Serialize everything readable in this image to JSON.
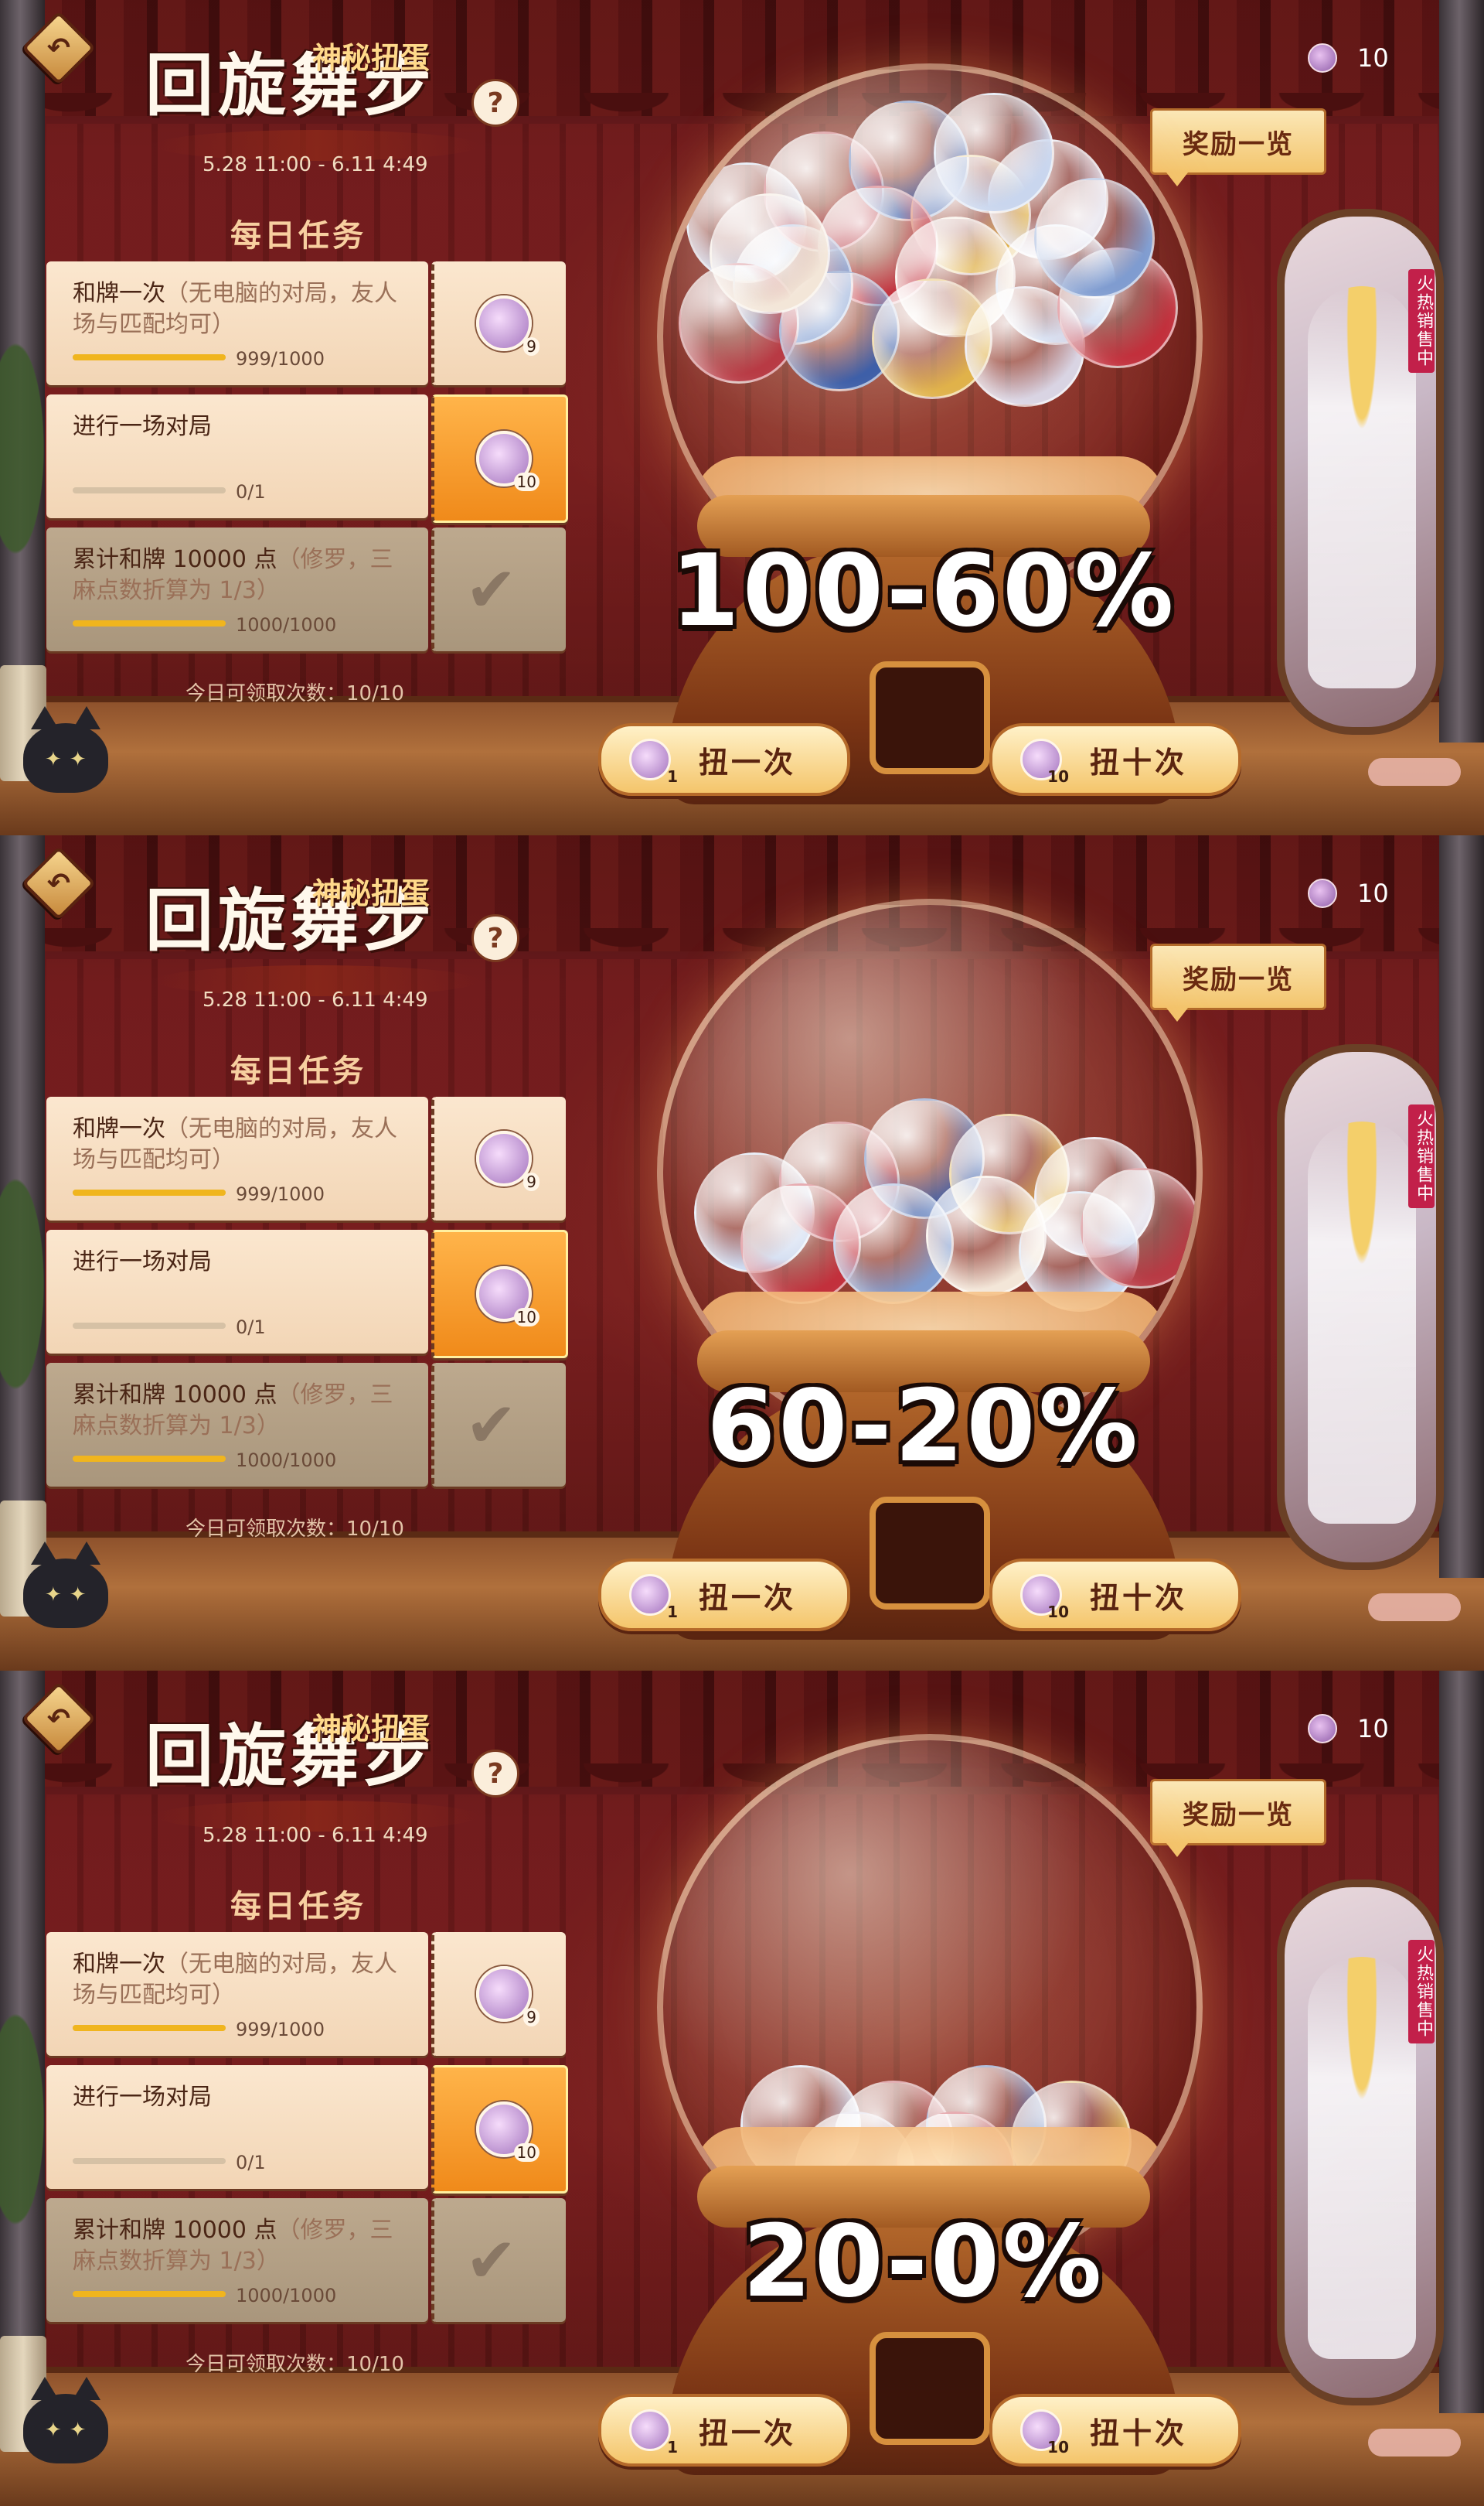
{
  "header": {
    "title_main": "回旋舞步",
    "title_sub": "神秘扭蛋",
    "date_range": "5.28 11:00 - 6.11 4:49",
    "help_label": "?"
  },
  "currency": {
    "count": "10"
  },
  "reward_list_label": "奖励一览",
  "tasks_title": "每日任务",
  "tasks": [
    {
      "desc": "和牌一次",
      "hint": "（无电脑的对局，友人场与匹配均可）",
      "progress": "999/1000",
      "progress_fraction": 0.999,
      "reward_count": "9",
      "state": "normal"
    },
    {
      "desc": "进行一场对局",
      "hint": "",
      "progress": "0/1",
      "progress_fraction": 0,
      "reward_count": "10",
      "state": "active"
    },
    {
      "desc": "累计和牌 10000 点",
      "hint": "（修罗，三麻点数折算为 1/3）",
      "progress": "1000/1000",
      "progress_fraction": 1,
      "reward_count": "",
      "state": "done"
    }
  ],
  "daily_limit": "今日可领取次数：10/10",
  "draw_one": {
    "label": "扭一次",
    "cost": "1"
  },
  "draw_ten": {
    "label": "扭十次",
    "cost": "10"
  },
  "hot_tag": "火热销售中",
  "panels": [
    {
      "percent": "100-60%",
      "capsule_fill": "full"
    },
    {
      "percent": "60-20%",
      "capsule_fill": "half"
    },
    {
      "percent": "20-0%",
      "capsule_fill": "low"
    }
  ],
  "colors": {
    "accent": "#f08a1a",
    "bar": "#f0b51e",
    "hot_tag": "#c2204a"
  },
  "icons": {
    "back": "back-arrow-icon",
    "help": "question-icon",
    "coin": "swan-token-icon",
    "check": "checkmark-icon"
  }
}
